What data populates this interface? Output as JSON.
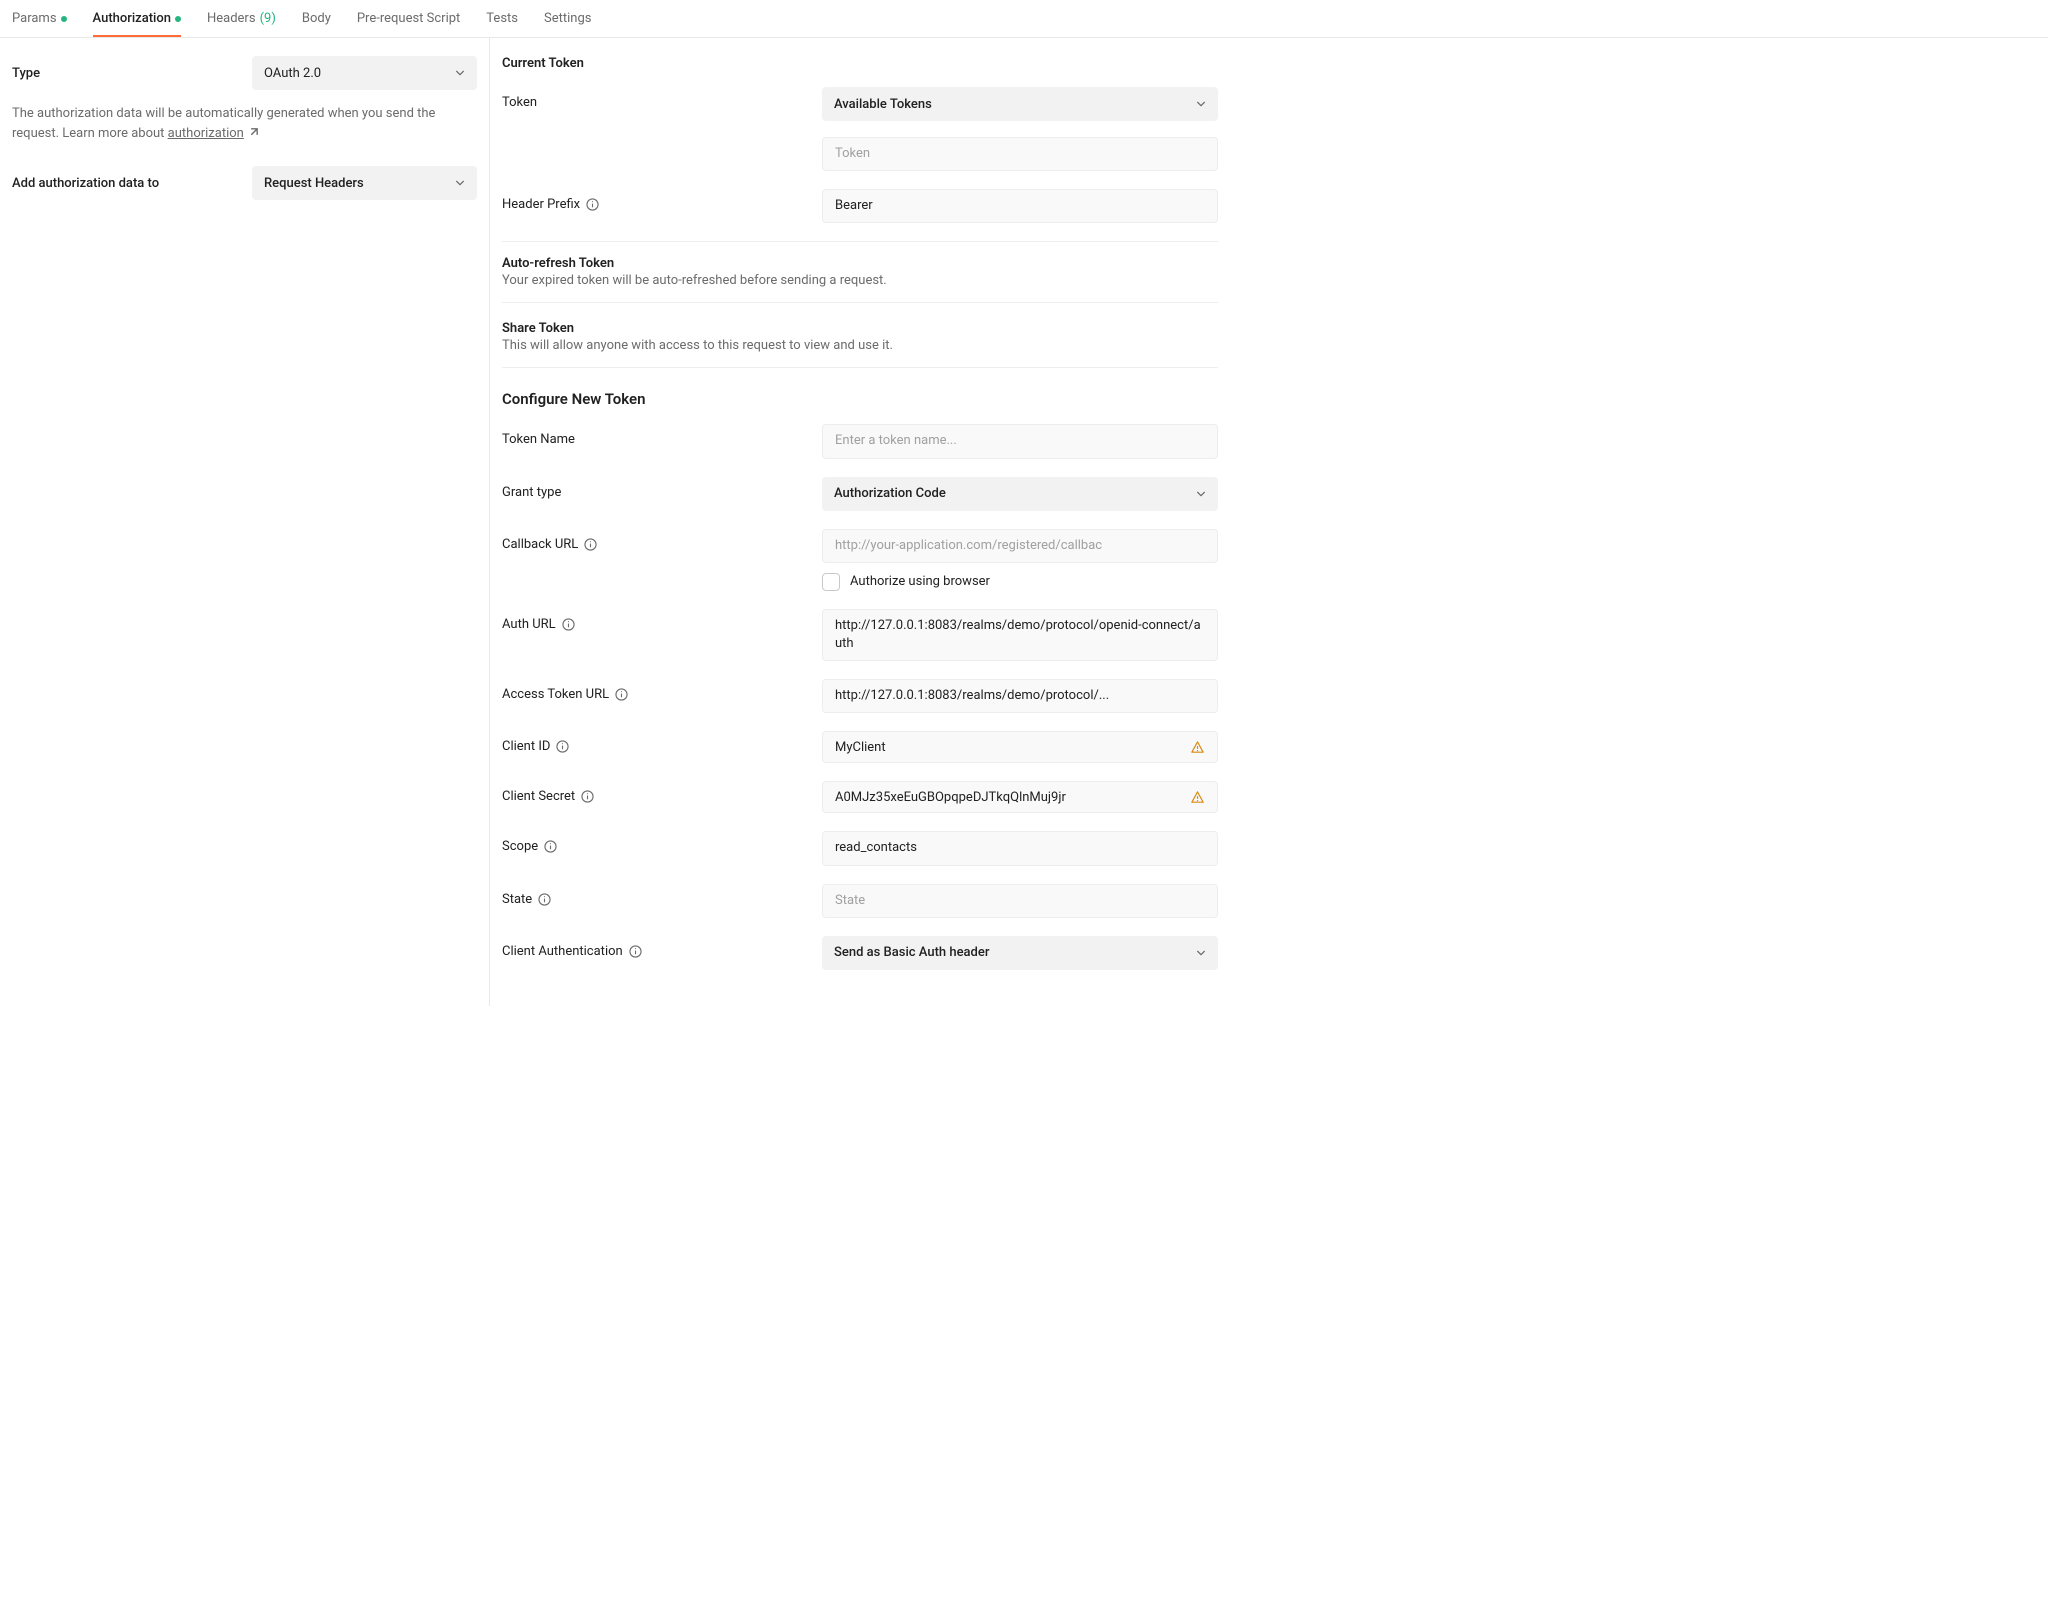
{
  "tabs": {
    "params": "Params",
    "authorization": "Authorization",
    "headers": "Headers",
    "headers_count": "(9)",
    "body": "Body",
    "prerequest": "Pre-request Script",
    "tests": "Tests",
    "settings": "Settings"
  },
  "left": {
    "type_label": "Type",
    "type_value": "OAuth 2.0",
    "help_text1": "The authorization data will be automatically generated when you send the request. Learn more about ",
    "help_link": "authorization",
    "add_to_label": "Add authorization data to",
    "add_to_value": "Request Headers"
  },
  "right": {
    "current_token_title": "Current Token",
    "token_label": "Token",
    "available_tokens": "Available Tokens",
    "token_placeholder": "Token",
    "header_prefix_label": "Header Prefix",
    "header_prefix_value": "Bearer",
    "autorefresh_title": "Auto-refresh Token",
    "autorefresh_desc": "Your expired token will be auto-refreshed before sending a request.",
    "share_title": "Share Token",
    "share_desc": "This will allow anyone with access to this request to view and use it.",
    "configure_title": "Configure New Token",
    "token_name_label": "Token Name",
    "token_name_placeholder": "Enter a token name...",
    "grant_type_label": "Grant type",
    "grant_type_value": "Authorization Code",
    "callback_label": "Callback URL",
    "callback_placeholder": "http://your-application.com/registered/callbac",
    "authorize_browser": "Authorize using browser",
    "auth_url_label": "Auth URL",
    "auth_url_value": "http://127.0.0.1:8083/realms/demo/protocol/openid-connect/auth",
    "access_token_url_label": "Access Token URL",
    "access_token_url_value": "http://127.0.0.1:8083/realms/demo/protocol/...",
    "client_id_label": "Client ID",
    "client_id_value": "MyClient",
    "client_secret_label": "Client Secret",
    "client_secret_value": "A0MJz35xeEuGBOpqpeDJTkqQlnMuj9jr",
    "scope_label": "Scope",
    "scope_value": "read_contacts",
    "state_label": "State",
    "state_placeholder": "State",
    "client_auth_label": "Client Authentication",
    "client_auth_value": "Send as Basic Auth header"
  }
}
